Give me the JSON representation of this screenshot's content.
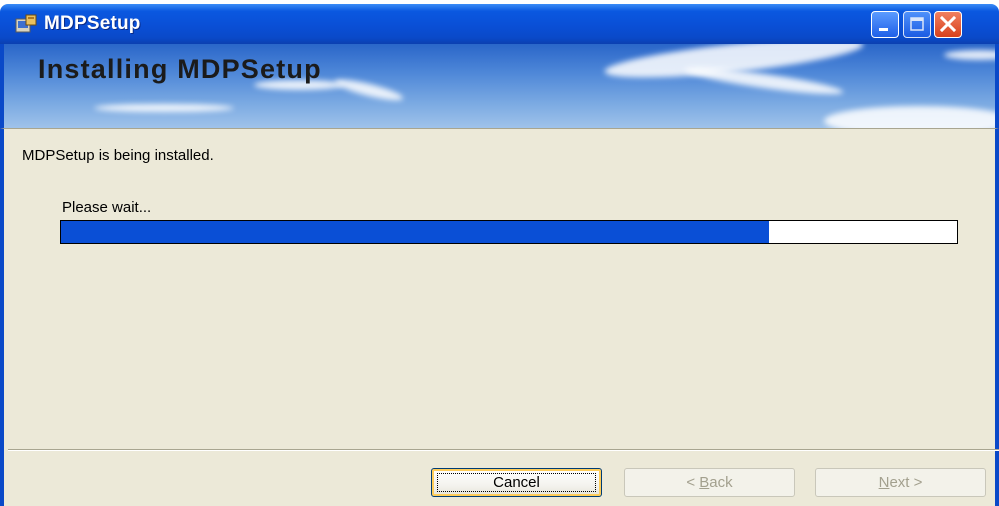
{
  "window": {
    "title": "MDPSetup"
  },
  "banner": {
    "title": "Installing MDPSetup"
  },
  "main": {
    "status_text": "MDPSetup is being installed.",
    "wait_text": "Please wait...",
    "progress_fraction": 0.79
  },
  "buttons": {
    "cancel_label": "Cancel",
    "back_prefix": "< ",
    "back_accel": "B",
    "back_rest": "ack",
    "next_accel": "N",
    "next_rest": "ext >"
  },
  "icons": {
    "app": "installer-icon",
    "minimize": "minimize-icon",
    "maximize": "maximize-icon",
    "close": "close-icon"
  },
  "colors": {
    "titlebar": "#0a4fd6",
    "progress_fill": "#0a4fd6",
    "dialog_bg": "#ece9d8",
    "close_button": "#d8401c"
  }
}
